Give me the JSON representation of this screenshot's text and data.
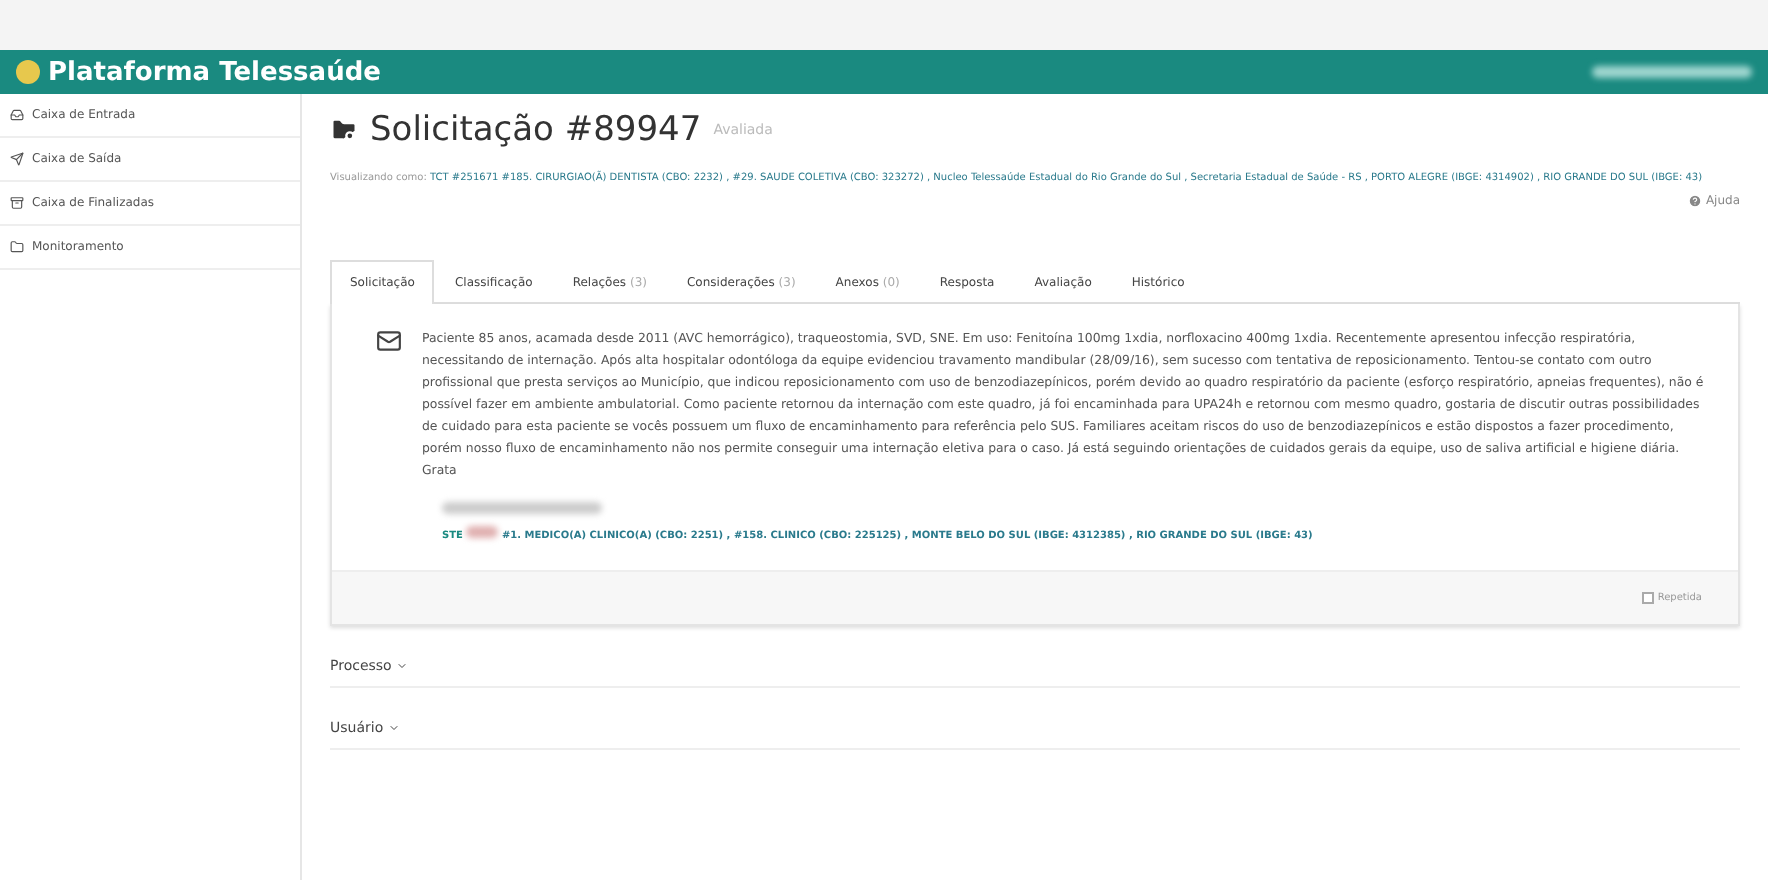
{
  "header": {
    "title": "Plataforma Telessaúde"
  },
  "sidebar": {
    "items": [
      {
        "label": "Caixa de Entrada",
        "selected": false
      },
      {
        "label": "Caixa de Saída",
        "selected": false
      },
      {
        "label": "Caixa de Finalizadas",
        "selected": false
      },
      {
        "label": "Monitoramento",
        "selected": false
      }
    ]
  },
  "page": {
    "title": "Solicitação #89947",
    "status": "Avaliada",
    "viewing_as_label": "Visualizando como:",
    "viewing_as": "TCT #251671 #185. CIRURGIAO(Ã) DENTISTA (CBO: 2232) , #29. SAUDE COLETIVA (CBO: 323272) , Nucleo Telessaúde Estadual do Rio Grande do Sul , Secretaria Estadual de Saúde - RS , PORTO ALEGRE (IBGE: 4314902) , RIO GRANDE DO SUL (IBGE: 43)",
    "help": "Ajuda"
  },
  "tabs": [
    {
      "label": "Solicitação",
      "selected": true
    },
    {
      "label": "Classificação",
      "selected": false
    },
    {
      "label": "Relações",
      "count": "(3)",
      "selected": false
    },
    {
      "label": "Considerações",
      "count": "(3)",
      "selected": false
    },
    {
      "label": "Anexos",
      "count": "(0)",
      "selected": false
    },
    {
      "label": "Resposta",
      "selected": false
    },
    {
      "label": "Avaliação",
      "selected": false
    },
    {
      "label": "Histórico",
      "selected": false
    }
  ],
  "message": {
    "text": "Paciente 85 anos, acamada desde 2011 (AVC hemorrágico), traqueostomia, SVD, SNE. Em uso: Fenitoína 100mg 1xdia, norfloxacino 400mg 1xdia. Recentemente apresentou infecção respiratória, necessitando de internação. Após alta hospitalar odontóloga da equipe evidenciou travamento mandibular (28/09/16), sem sucesso com tentativa de reposicionamento. Tentou-se contato com outro profissional que presta serviços ao Município, que indicou reposicionamento com uso de benzodiazepínicos, porém devido ao quadro respiratório da paciente (esforço respiratório, apneias frequentes), não é possível fazer em ambiente ambulatorial. Como paciente retornou da internação com este quadro, já foi encaminhada para UPA24h e retornou com mesmo quadro, gostaria de discutir outras possibilidades de cuidado para esta paciente se vocês possuem um fluxo de encaminhamento para referência pelo SUS. Familiares aceitam riscos do uso de benzodiazepínicos e estão dispostos a fazer procedimento, porém nosso fluxo de encaminhamento não nos permite conseguir uma internação eletiva para o caso. Já está seguindo orientações de cuidados gerais da equipe, uso de saliva artificial e higiene diária. Grata",
    "author_role": "STE",
    "author_detail": "#1. MEDICO(A) CLINICO(A) (CBO: 2251) , #158. CLINICO (CBO: 225125) , MONTE BELO DO SUL (IBGE: 4312385) , RIO GRANDE DO SUL (IBGE: 43)",
    "repeated": {
      "label": "Repetida",
      "checked": false
    }
  },
  "sections": [
    {
      "label": "Processo",
      "expanded": false
    },
    {
      "label": "Usuário",
      "expanded": false
    }
  ]
}
